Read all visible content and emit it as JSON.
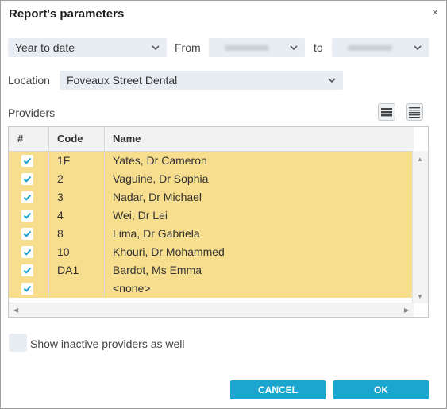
{
  "dialog": {
    "title": "Report's parameters",
    "close_glyph": "×"
  },
  "period": {
    "selected": "Year to date",
    "from_label": "From",
    "to_label": "to"
  },
  "location": {
    "label": "Location",
    "selected": "Foveaux Street Dental"
  },
  "providers": {
    "label": "Providers",
    "columns": [
      "#",
      "Code",
      "Name"
    ],
    "rows": [
      {
        "checked": true,
        "code": "1F",
        "name": "Yates, Dr Cameron"
      },
      {
        "checked": true,
        "code": "2",
        "name": "Vaguine, Dr Sophia"
      },
      {
        "checked": true,
        "code": "3",
        "name": "Nadar, Dr Michael"
      },
      {
        "checked": true,
        "code": "4",
        "name": "Wei, Dr Lei"
      },
      {
        "checked": true,
        "code": "8",
        "name": "Lima, Dr Gabriela"
      },
      {
        "checked": true,
        "code": "10",
        "name": "Khouri, Dr Mohammed"
      },
      {
        "checked": true,
        "code": "DA1",
        "name": "Bardot, Ms Emma"
      },
      {
        "checked": true,
        "code": "",
        "name": "<none>"
      }
    ]
  },
  "inactive": {
    "label": "Show inactive providers as well",
    "checked": false
  },
  "buttons": {
    "cancel": "CANCEL",
    "ok": "OK"
  },
  "colors": {
    "accent": "#1aa6cf",
    "row_selected": "#f7de8f",
    "checkmark": "#1a9fd0",
    "field_bg": "#e7edf2"
  }
}
